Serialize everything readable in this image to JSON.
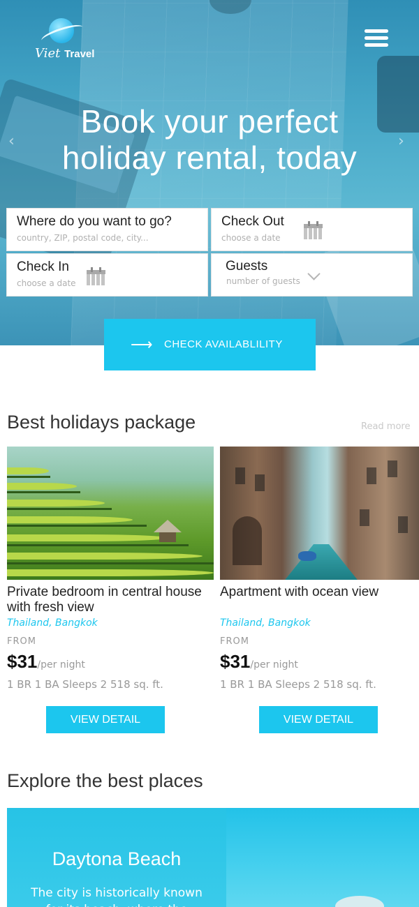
{
  "brand": {
    "logo_script": "Viet",
    "logo_bold": "Travel"
  },
  "hero": {
    "title_line1": "Book your perfect",
    "title_line2": "holiday rental, today",
    "prev_arrow": "‹",
    "next_arrow": "›"
  },
  "search": {
    "destination": {
      "label": "Where do you want to go?",
      "placeholder": "country, ZIP, postal code, city..."
    },
    "check_out": {
      "label": "Check Out",
      "placeholder": "choose a date"
    },
    "check_in": {
      "label": "Check In",
      "placeholder": "choose a date"
    },
    "guests": {
      "label": "Guests",
      "placeholder": "number of guests"
    },
    "submit_arrow": "⟶",
    "submit_label": "CHECK AVAILABLILITY"
  },
  "packages": {
    "heading": "Best holidays package",
    "read_more": "Read more",
    "items": [
      {
        "title": "Private bedroom in central house with fresh view",
        "location": "Thailand, Bangkok",
        "from": "FROM",
        "price": "$31",
        "per": "/per night",
        "details": "1 BR 1 BA Sleeps 2 518 sq. ft.",
        "button": "VIEW DETAIL"
      },
      {
        "title": "Apartment with ocean view",
        "location": "Thailand, Bangkok",
        "from": "FROM",
        "price": "$31",
        "per": "/per night",
        "details": "1 BR 1 BA Sleeps 2 518 sq. ft.",
        "button": "VIEW DETAIL"
      }
    ]
  },
  "explore": {
    "heading": "Explore the best places",
    "place_name": "Daytona Beach",
    "place_desc": "The city is historically known for its beach, where the"
  },
  "colors": {
    "accent": "#1cc6ee",
    "heading": "#333333",
    "muted": "#999999"
  }
}
